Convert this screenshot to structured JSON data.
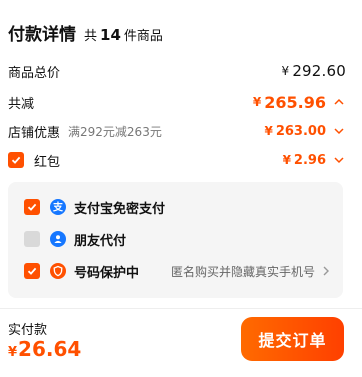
{
  "header": {
    "title": "付款详情",
    "count_prefix": "共",
    "count": "14",
    "count_suffix": "件商品"
  },
  "rows": {
    "subtotal": {
      "label": "商品总价",
      "currency": "¥",
      "value": "292.60"
    },
    "discount": {
      "label": "共减",
      "currency": "¥",
      "value": "265.96"
    },
    "store": {
      "label": "店铺优惠",
      "note": "满292元减263元",
      "currency": "¥",
      "value": "263.00"
    },
    "redpacket": {
      "label": "红包",
      "currency": "¥",
      "value": "2.96",
      "checked": true
    }
  },
  "payment_options": [
    {
      "label": "支付宝免密支付",
      "checked": true,
      "icon": "alipay-icon"
    },
    {
      "label": "朋友代付",
      "checked": false,
      "icon": "friend-pay-icon"
    },
    {
      "label": "号码保护中",
      "checked": true,
      "icon": "shield-icon",
      "desc": "匿名购买并隐藏真实手机号"
    }
  ],
  "footer": {
    "paid_label": "实付款",
    "currency": "¥",
    "paid_amount": "26.64",
    "submit_label": "提交订单"
  },
  "colors": {
    "accent": "#ff5000",
    "alipay_blue": "#1677ff",
    "checkbox_off": "#d9d9d9"
  }
}
